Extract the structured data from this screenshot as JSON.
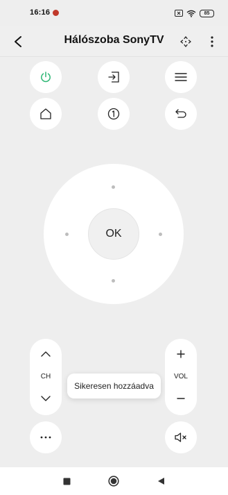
{
  "status_bar": {
    "time": "16:16",
    "battery": "85"
  },
  "header": {
    "title": "Hálószoba SonyTV"
  },
  "remote": {
    "ok_label": "OK",
    "channel_label": "CH",
    "volume_label": "VOL"
  },
  "toast": {
    "message": "Sikeresen hozzáadva"
  },
  "colors": {
    "background": "#eeeeee",
    "button": "#ffffff",
    "power_accent": "#2bb673"
  },
  "icons": {
    "power": "power-icon",
    "input": "input-icon",
    "menu": "menu-icon",
    "home": "home-icon",
    "number": "number-icon",
    "back": "return-icon",
    "mute": "mute-icon"
  }
}
